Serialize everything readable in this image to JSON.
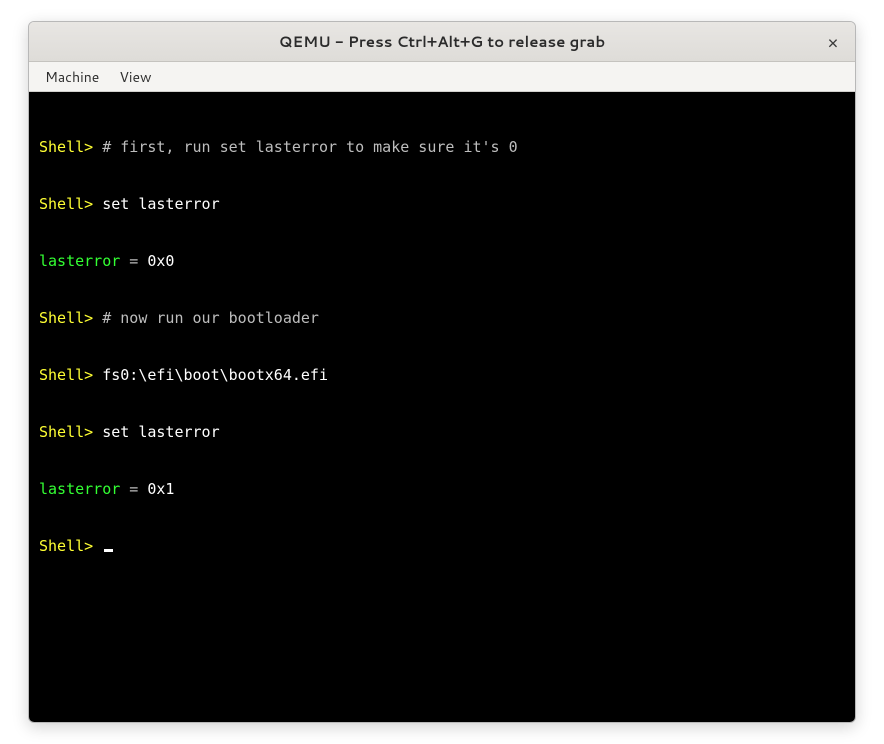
{
  "window": {
    "title": "QEMU - Press Ctrl+Alt+G to release grab",
    "close_glyph": "×"
  },
  "menubar": {
    "machine": "Machine",
    "view": "View"
  },
  "terminal": {
    "prompt": "Shell> ",
    "line1_comment": "# first, run set lasterror to make sure it's 0",
    "line2_cmd": "set lasterror",
    "line3_var": "lasterror",
    "line3_eq": " = ",
    "line3_val": "0x0",
    "line4_comment": "# now run our bootloader",
    "line5_cmd": "fs0:\\efi\\boot\\bootx64.efi",
    "line6_cmd": "set lasterror",
    "line7_var": "lasterror",
    "line7_eq": " = ",
    "line7_val": "0x1"
  }
}
